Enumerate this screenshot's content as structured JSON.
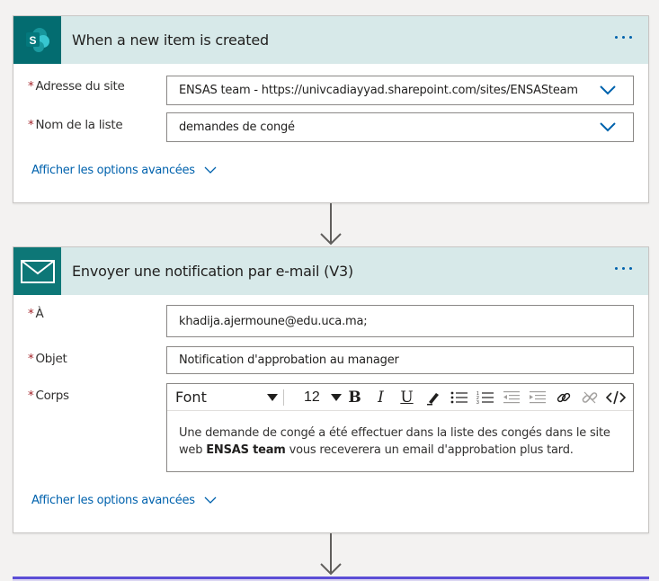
{
  "trigger": {
    "title": "When a new item is created",
    "fields": [
      {
        "required_mark": "*",
        "label": "Adresse du site",
        "value": "ENSAS team - https://univcadiayyad.sharepoint.com/sites/ENSASteam"
      },
      {
        "required_mark": "*",
        "label": "Nom de la liste",
        "value": "demandes de congé"
      }
    ],
    "advanced_link": "Afficher les options avancées"
  },
  "action": {
    "title": "Envoyer une notification par e-mail (V3)",
    "to": {
      "required_mark": "*",
      "label": "À",
      "value": "khadija.ajermoune@edu.uca.ma;"
    },
    "subject": {
      "required_mark": "*",
      "label": "Objet",
      "value": "Notification d'approbation au manager"
    },
    "body": {
      "required_mark": "*",
      "label": "Corps",
      "toolbar": {
        "font": "Font",
        "size": "12"
      },
      "text_before": "Une demande de congé a été effectuer dans la liste des congés dans le site web ",
      "text_bold": "ENSAS team",
      "text_after": " vous receverera un email d'approbation plus tard."
    },
    "advanced_link": "Afficher les options avancées"
  },
  "colors": {
    "header_bg": "#d7e9e9",
    "sharepoint": "#036c70",
    "mail": "#0d7777",
    "link": "#0062ad",
    "required": "#a4262c"
  },
  "icons": [
    "sharepoint-icon",
    "mail-icon",
    "more-icon",
    "chevron-down-icon",
    "bold-icon",
    "italic-icon",
    "underline-icon",
    "highlight-icon",
    "bullet-list-icon",
    "numbered-list-icon",
    "decrease-indent-icon",
    "increase-indent-icon",
    "link-icon",
    "unlink-icon",
    "code-view-icon",
    "arrow-down-icon"
  ]
}
